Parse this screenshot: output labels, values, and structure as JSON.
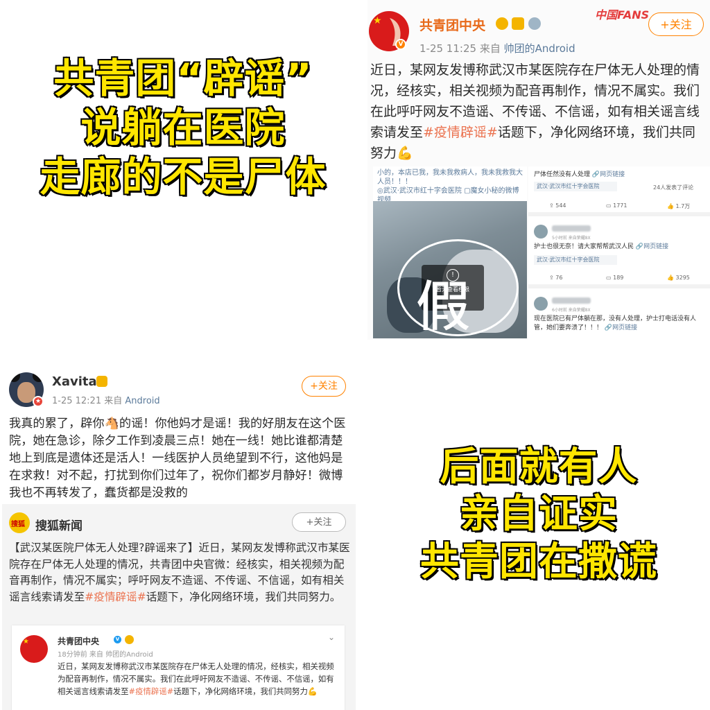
{
  "captions": {
    "top": [
      "共青团“辟谣”",
      "说躺在医院",
      "走廊的不是尸体"
    ],
    "bottom": [
      "后面就有人",
      "亲自证实",
      "共青团在撒谎"
    ]
  },
  "post_top": {
    "name": "共青团中央",
    "fans_logo": "中国FANS",
    "follow_label": "+关注",
    "time": "1-25 11:25",
    "source_prefix": "来自",
    "source": "帅团的Android",
    "text_before": "近日，某网友发博称武汉市某医院存在尸体无人处理的情况，经核实，相关视频为配音再制作，情况不属实。我们在此呼吁网友不造谣、不传谣、不信谣，如有相关谣言线索请发至",
    "hashtag": "#疫情辟谣#",
    "text_after": "话题下，净化网络环境，我们共同努力💪",
    "video": {
      "caption": "小的，本店已我，我未我救病人，我未我救我大人员！！！",
      "location": "◎武汉·武汉市红十字会医院 ▢魔女小秘的微博视频",
      "overlay_text": "暂无查看权限",
      "overlay_icon": "!",
      "stamp": "假"
    },
    "comments": [
      {
        "text": "尸体任然没有人处理",
        "link": "🔗网页链接",
        "location": "武汉·武汉市红十字会医院",
        "likes_note": "24人发表了评论",
        "reposts": "544",
        "comments": "1771",
        "likes": "1.7万"
      },
      {
        "time": "5小时前 来自荣耀8X",
        "text": "护士也很无奈！请大家帮帮武汉人民",
        "link": "🔗网页链接",
        "location": "武汉·武汉市红十字会医院",
        "reposts": "76",
        "comments": "189",
        "likes": "3295"
      },
      {
        "time": "6小时前 来自荣耀8X",
        "text": "现在医院已有尸体躺在那，没有人处理，护士打电话没有人管，她们要奔溃了！！！",
        "link": "🔗网页链接"
      }
    ]
  },
  "post_bottom": {
    "name": "Xavitas",
    "follow_label": "+关注",
    "time": "1-25 12:21",
    "source_prefix": "来自",
    "source": "Android",
    "text": "我真的累了，辟你🐴的谣！你他妈才是谣！我的好朋友在这个医院，她在急诊，除夕工作到凌晨三点！她在一线！她比谁都清楚地上到底是遗体还是活人！一线医护人员绝望到不行，这他妈是在求救！对不起，打扰到你们过年了，祝你们都岁月静好！微博我也不再转发了，蠢货都是没救的",
    "sohu": {
      "name": "搜狐新闻",
      "avatar_label": "搜狐",
      "follow_label": "+关注",
      "text_before": "【武汉某医院尸体无人处理?辟谣来了】近日，某网友发博称武汉市某医院存在尸体无人处理的情况，共青团中央官微：经核实，相关视频为配音再制作，情况不属实；呼吁网友不造谣、不传谣、不信谣，如有相关谣言线索请发至",
      "hashtag": "#疫情辟谣#",
      "text_after": "话题下，净化网络环境，我们共同努力。",
      "inner": {
        "name": "共青团中央",
        "meta": "18分钟前 来自 帅团的Android",
        "text_before": "近日，某网友发博称武汉市某医院存在尸体无人处理的情况，经核实，相关视频为配音再制作，情况不属实。我们在此呼吁网友不造谣、不传谣、不信谣，如有相关谣言线索请发至",
        "hashtag": "#疫情辟谣#",
        "text_after": "话题下，净化网络环境，我们共同努力💪"
      }
    }
  },
  "colors": {
    "caption_fill": "#ffe600",
    "weibo_orange": "#ff8200",
    "hashtag": "#eb7350",
    "name_orange": "#e86a1a"
  }
}
